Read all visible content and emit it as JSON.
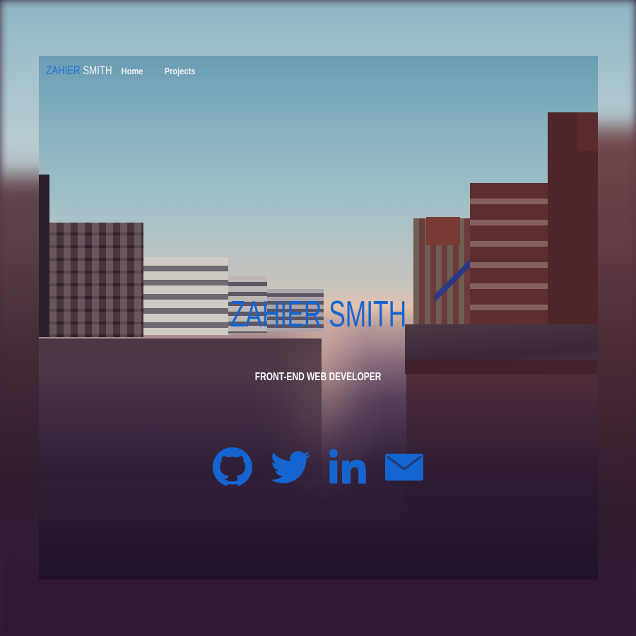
{
  "nav": {
    "brand_first": "ZAHIER",
    "brand_last": "SMITH",
    "links": [
      {
        "label": "Home"
      },
      {
        "label": "Projects"
      }
    ]
  },
  "hero": {
    "title": "ZAHIER SMITH",
    "subtitle": "FRONT-END WEB DEVELOPER"
  },
  "social": [
    {
      "icon": "github-icon"
    },
    {
      "icon": "twitter-icon"
    },
    {
      "icon": "linkedin-icon"
    },
    {
      "icon": "email-icon"
    }
  ],
  "colors": {
    "accent": "#1565d0",
    "nav_text": "#f0f0f0",
    "subtitle_text": "#ffffff"
  }
}
